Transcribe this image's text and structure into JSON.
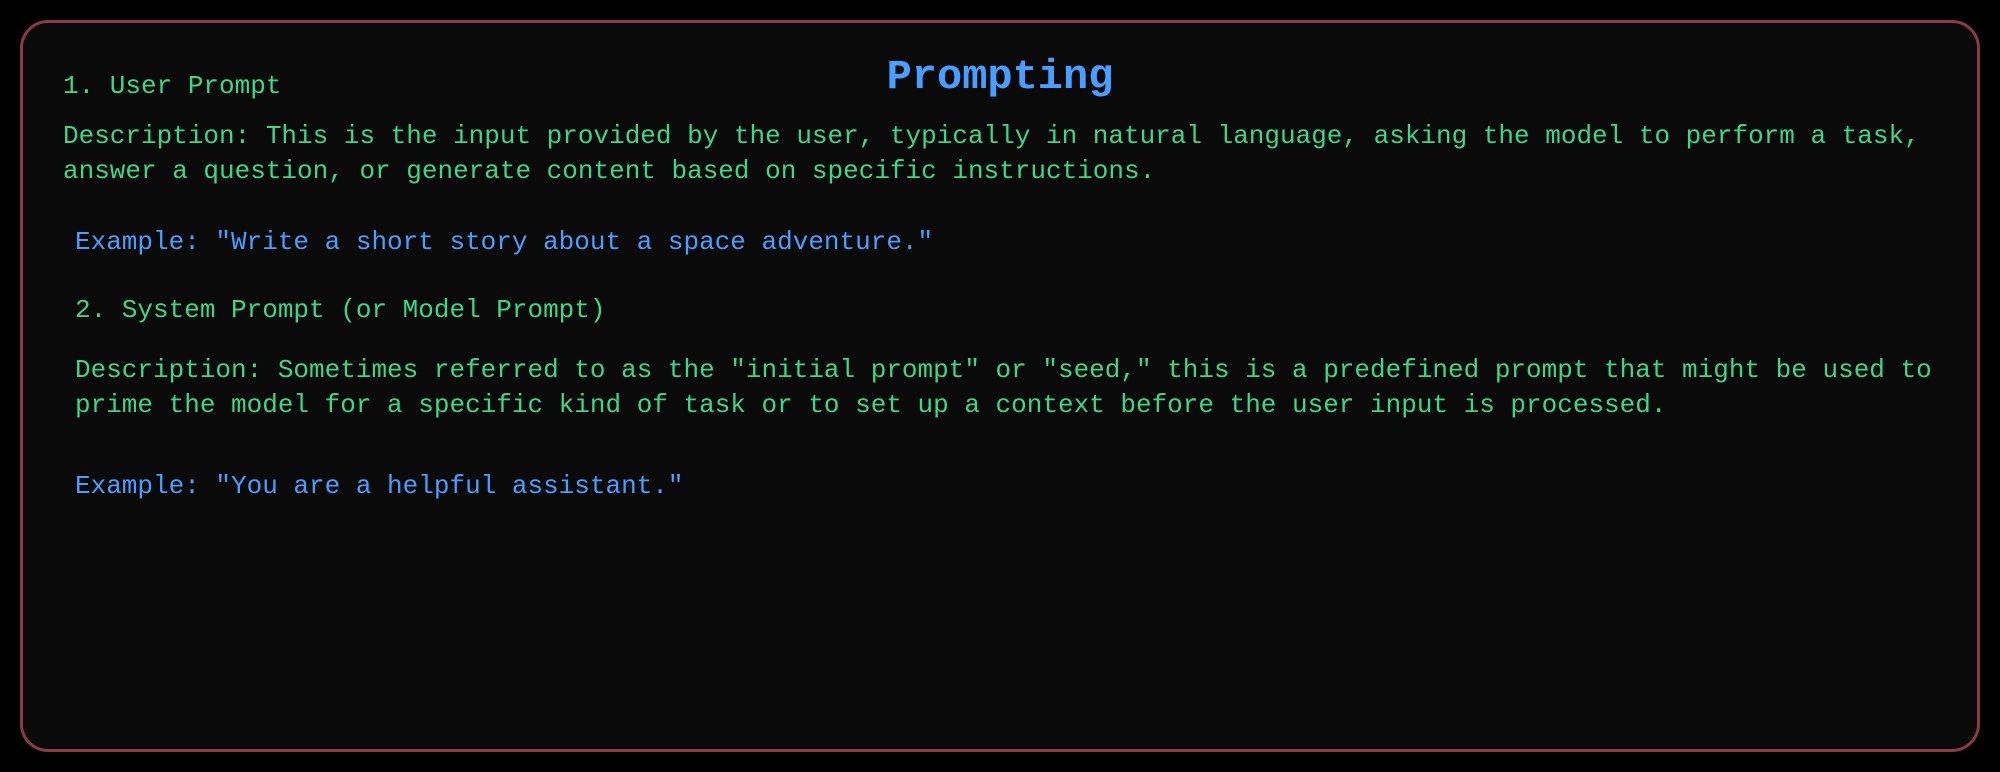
{
  "title": "Prompting",
  "sections": [
    {
      "heading": "1. User Prompt",
      "description": "Description: This is the input provided by the user, typically in natural language, asking the model to perform a task, answer a question, or generate content based on specific instructions.",
      "example": "Example: \"Write a short story about a space adventure.\""
    },
    {
      "heading": "2. System Prompt (or Model Prompt)",
      "description": "Description: Sometimes referred to as the \"initial prompt\" or \"seed,\" this is a predefined prompt that might be used to prime the model for a specific kind of task or to set up a context before the user input is processed.",
      "example": "Example: \"You are a helpful assistant.\""
    }
  ]
}
